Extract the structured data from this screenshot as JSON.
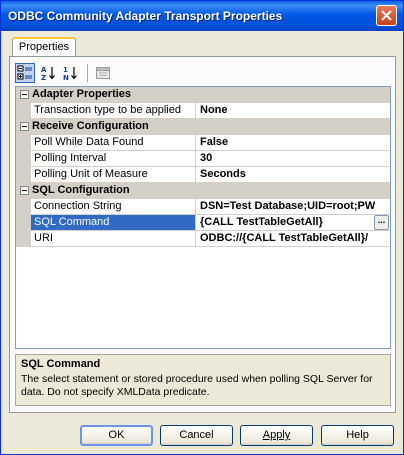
{
  "window": {
    "title": "ODBC Community Adapter Transport Properties"
  },
  "tabs": [
    {
      "label": "Properties"
    }
  ],
  "toolbar": {
    "categorized": "categorized-icon",
    "alphabetical": "sort-alphabetical-icon",
    "sort_order": "sort-numeric-icon",
    "property_pages": "property-pages-icon"
  },
  "grid": {
    "categories": [
      {
        "name": "Adapter Properties"
      },
      {
        "name": "Receive Configuration"
      },
      {
        "name": "SQL Configuration"
      }
    ],
    "properties": [
      {
        "name": "Transaction type to be applied",
        "value": "None"
      },
      {
        "name": "Poll While Data Found",
        "value": "False"
      },
      {
        "name": "Polling Interval",
        "value": "30"
      },
      {
        "name": "Polling Unit of Measure",
        "value": "Seconds"
      },
      {
        "name": "Connection String",
        "value": "DSN=Test Database;UID=root;PW"
      },
      {
        "name": "SQL Command",
        "value": "{CALL TestTableGetAll}"
      },
      {
        "name": "URI",
        "value": "ODBC://{CALL TestTableGetAll}/"
      }
    ],
    "selected_property": "SQL Command",
    "ellipsis_label": "..."
  },
  "description": {
    "title": "SQL Command",
    "text": "The select statement or stored procedure used when polling SQL Server for data. Do not specify XMLData predicate."
  },
  "buttons": {
    "ok": "OK",
    "cancel": "Cancel",
    "apply": "Apply",
    "help": "Help"
  },
  "colors": {
    "selection": "#316ac5",
    "titlebar": "#0058e6",
    "window_bg": "#ece9d8"
  }
}
